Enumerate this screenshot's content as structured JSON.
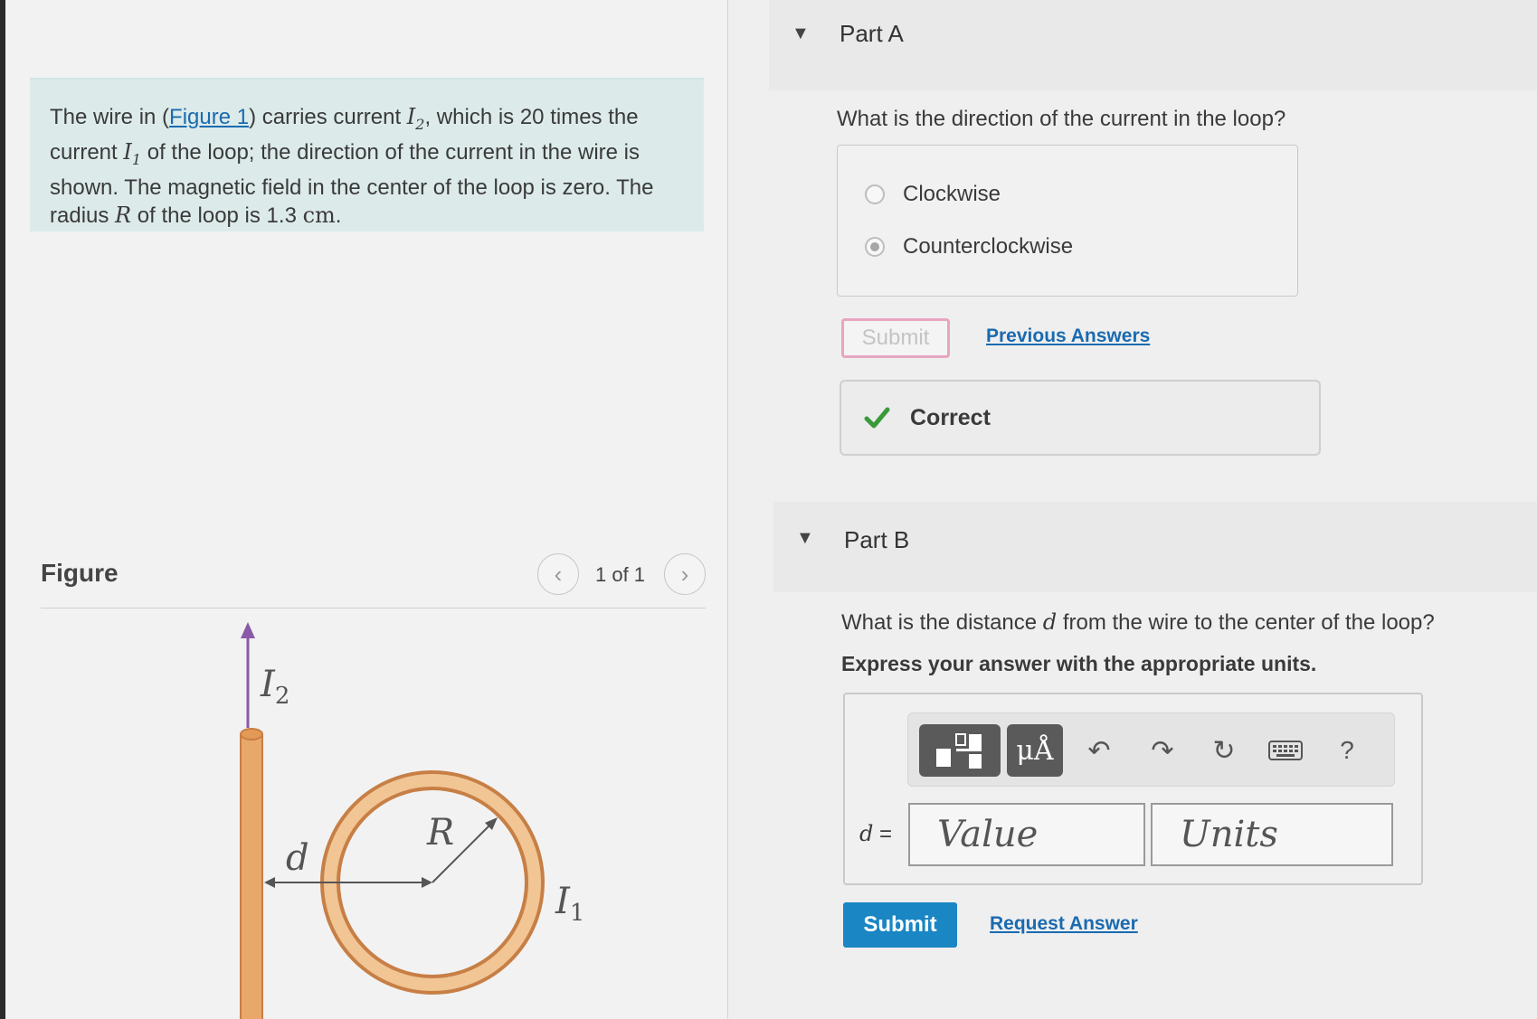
{
  "problem": {
    "text_1": "The wire in (",
    "figure_link": "Figure 1",
    "text_2": ") carries current ",
    "I2_var": "I",
    "I2_sub": "2",
    "text_3": ", which is 20 times the current ",
    "I1_var": "I",
    "I1_sub": "1",
    "text_4": " of the loop; the direction of the current in the wire is shown. The magnetic field in the center of the loop is zero. The radius ",
    "R_var": "R",
    "text_5": " of the loop is 1.3 ",
    "unit": "cm",
    "text_6": "."
  },
  "figure": {
    "label": "Figure",
    "counter": "1 of 1",
    "prev_icon": "chevron-left-icon",
    "next_icon": "chevron-right-icon",
    "labels": {
      "I2": "I",
      "I2_sub": "2",
      "d": "d",
      "R": "R",
      "I1": "I",
      "I1_sub": "1"
    },
    "wire_color": "#e8a86a",
    "arrow_color": "#8a5aa8"
  },
  "partA": {
    "title": "Part A",
    "question": "What is the direction of the current in the loop?",
    "options": [
      {
        "label": "Clockwise",
        "selected": false
      },
      {
        "label": "Counterclockwise",
        "selected": true
      }
    ],
    "submit_label": "Submit",
    "previous_answers": "Previous Answers",
    "feedback": "Correct",
    "feedback_color": "#3a9a3a"
  },
  "partB": {
    "title": "Part B",
    "question_1": "What is the distance ",
    "question_var": "d",
    "question_2": " from the wire to the center of the loop?",
    "instruction": "Express your answer with the appropriate units.",
    "toolbar": {
      "units_btn": "μÅ",
      "help": "?"
    },
    "d_label_var": "d",
    "d_label_eq": " =",
    "value_placeholder": "Value",
    "units_placeholder": "Units",
    "submit_label": "Submit",
    "request_answer": "Request Answer",
    "accent_color": "#1a86c3"
  }
}
